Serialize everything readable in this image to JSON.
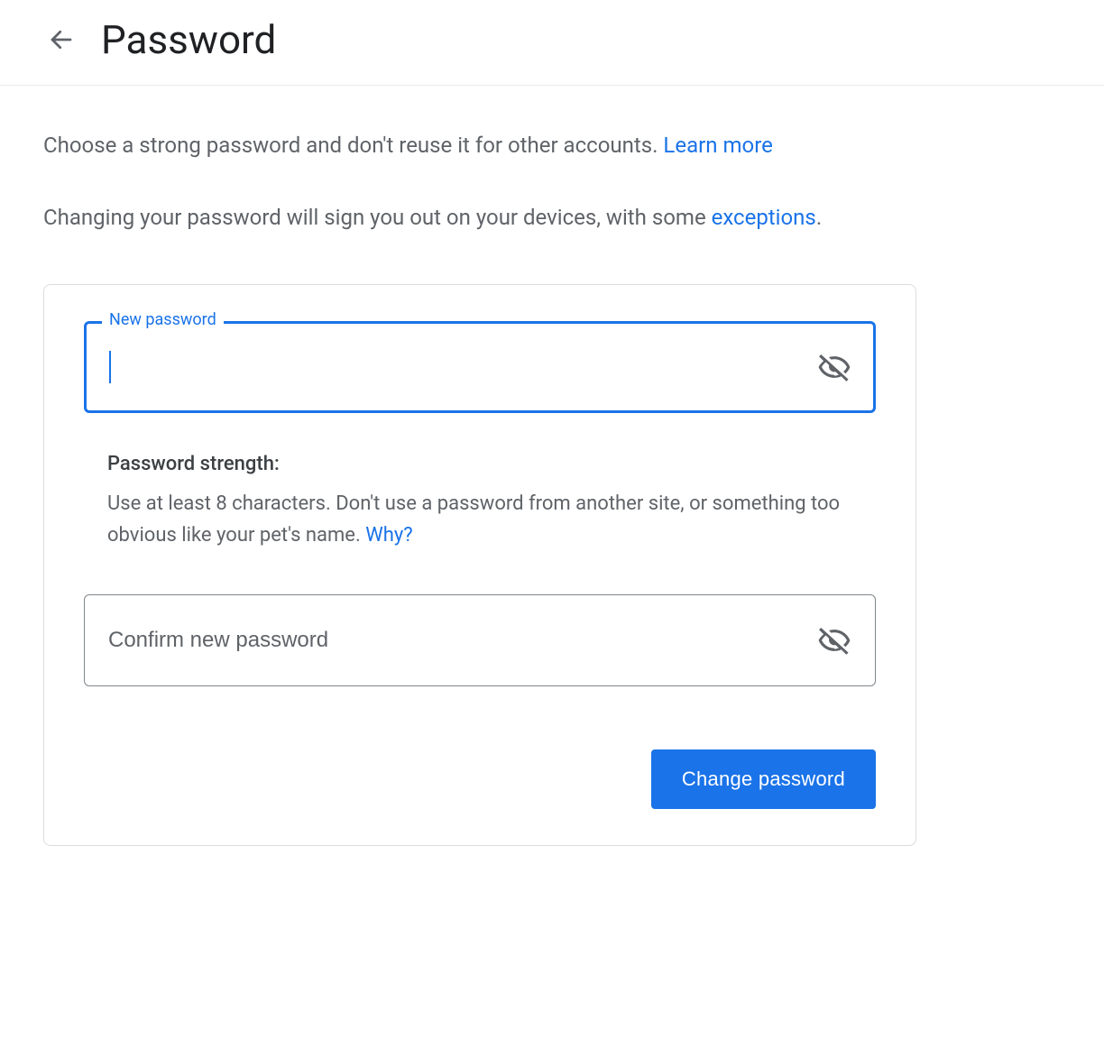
{
  "header": {
    "title": "Password"
  },
  "intro": {
    "line1_before": "Choose a strong password and don't reuse it for other accounts. ",
    "learn_more": "Learn more",
    "line2_before": "Changing your password will sign you out on your devices, with some ",
    "exceptions": "exceptions",
    "line2_after": "."
  },
  "form": {
    "new_password": {
      "label": "New password",
      "value": ""
    },
    "strength": {
      "title": "Password strength:",
      "text": "Use at least 8 characters. Don't use a password from another site, or something too obvious like your pet's name. ",
      "why_link": "Why?"
    },
    "confirm": {
      "placeholder": "Confirm new password",
      "value": ""
    },
    "submit_label": "Change password"
  },
  "icons": {
    "back": "back-arrow",
    "visibility_off": "eye-off"
  }
}
